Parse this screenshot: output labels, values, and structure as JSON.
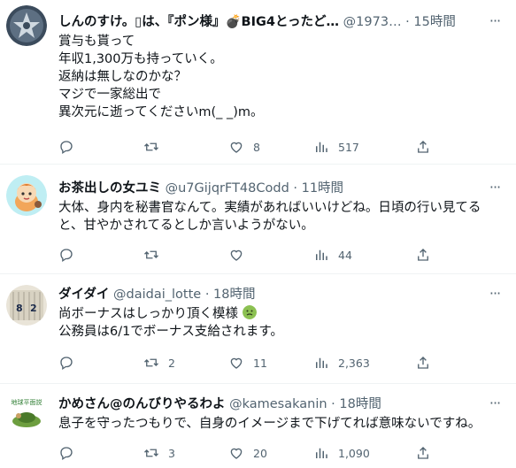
{
  "tweets": [
    {
      "name": "しんのすけ。▯は、『ポン様』💣BIG4とったど…",
      "meta": "@1973… · 15時間",
      "lines": [
        "賞与も貰って",
        "年収1,300万も持っていく。",
        "返納は無しなのかな？",
        "マジで一家総出で",
        "異次元に逝ってくださいm(_ _)m。"
      ],
      "replies": "",
      "retweets": "",
      "likes": "8",
      "views": "517"
    },
    {
      "name": "お茶出しの女ユミ",
      "meta": "@u7GijqrFT48Codd · 11時間",
      "lines": [
        "大体、身内を秘書官なんて。実績があればいいけどね。日頃の行い見てる",
        "と、甘やかされてるとしか言いようがない。"
      ],
      "replies": "",
      "retweets": "",
      "likes": "",
      "views": "44"
    },
    {
      "name": "ダイダイ",
      "meta": "@daidai_lotte · 18時間",
      "lines": [
        "尚ボーナスはしっかり頂く模様",
        "公務員は6/1でボーナス支給されます。"
      ],
      "replies": "",
      "retweets": "2",
      "likes": "11",
      "views": "2,363"
    },
    {
      "name": "かめさん@のんびりやるわよ",
      "meta": "@kamesakanin · 18時間",
      "lines": [
        "息子を守ったつもりで、自身のイメージまで下げてれば意味ないですね。"
      ],
      "replies": "",
      "retweets": "3",
      "likes": "20",
      "views": "1,090"
    }
  ],
  "avatar_text": "地球平面説",
  "colors": {
    "text": "#0f1419",
    "secondary": "#536471",
    "divider": "#eff3f4"
  },
  "icons": {
    "reply": "reply-icon",
    "retweet": "retweet-icon",
    "like": "heart-icon",
    "views": "views-icon",
    "share": "share-icon",
    "more": "more-icon"
  }
}
